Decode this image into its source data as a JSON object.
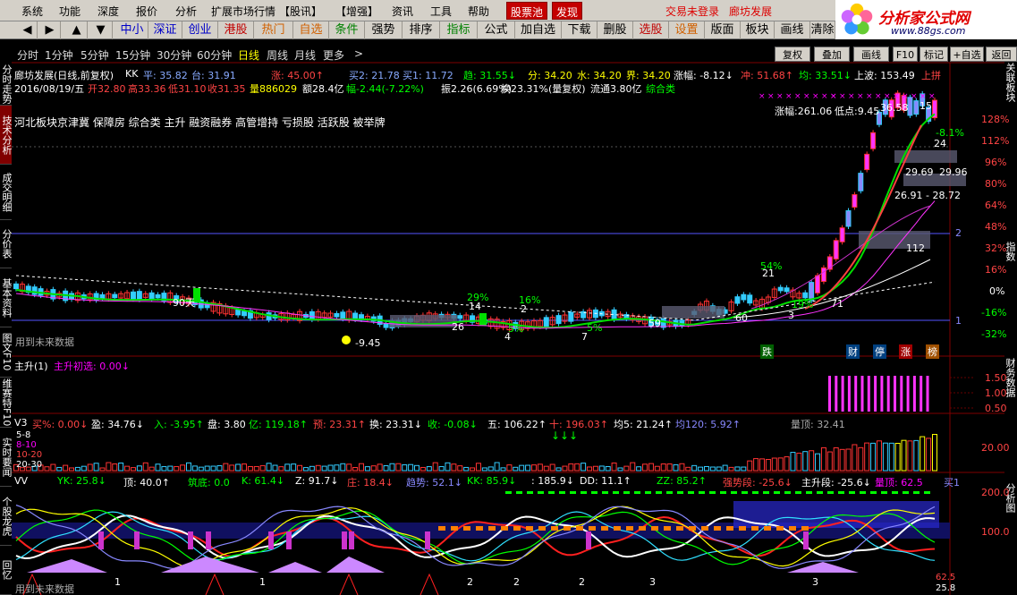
{
  "menu": {
    "items": [
      "系统",
      "功能",
      "深度",
      "报价",
      "分析",
      "扩展市场行情",
      "【股讯】",
      "【增强】",
      "资讯",
      "工具",
      "帮助"
    ],
    "stock_pool": "股票池",
    "discover": "发现",
    "status_left": "交易未登录",
    "status_right": "廊坊发展"
  },
  "logo": {
    "title": "分析家公式网",
    "url": "www.88gs.com"
  },
  "toolbar": {
    "nav": [
      "◀",
      "▶",
      "▲",
      "▼"
    ],
    "items": [
      "中小",
      "深证",
      "创业",
      "港股",
      "热门",
      "自选",
      "条件",
      "强势",
      "排序",
      "指标",
      "公式",
      "加自选",
      "下载",
      "删股",
      "选股",
      "设置",
      "版面",
      "板块",
      "画线",
      "清除"
    ]
  },
  "periods": [
    "分时",
    "1分钟",
    "5分钟",
    "15分钟",
    "30分钟",
    "60分钟",
    "日线",
    "周线",
    "月线",
    "更多",
    ">"
  ],
  "right_buttons": [
    "复权",
    "叠加",
    "画线",
    "F10",
    "标记",
    "+自选",
    "返回"
  ],
  "left_tabs": [
    "分时走势",
    "技术分析",
    "成交明细",
    "分价表",
    "基本资料",
    "图文F10",
    "维赛特F10",
    "实时要闻",
    "个股龙虎",
    "回忆"
  ],
  "right_tabs": [
    "关联板块",
    "指数",
    "财务数据",
    "分析图"
  ],
  "header": {
    "name": "廊坊发展(日线,前复权)",
    "kk": "KK",
    "ping": "平: 35.82",
    "tai": "台: 31.91",
    "zhang": "涨: 45.00↑",
    "mai2": "买2: 21.78",
    "mai1": "买1: 11.72",
    "qu": "趋: 31.55↓",
    "fen": "分: 34.20",
    "shui": "水: 34.20",
    "jie": "界: 34.20",
    "zhangfu": "涨幅: -8.12↓",
    "chong": "冲: 51.68↑",
    "jun": "均: 33.51↓",
    "shangbo": "上波: 153.49",
    "shangjin": "上拼"
  },
  "info_line": {
    "date": "2016/08/19/五",
    "open": "开32.80",
    "high": "高33.36",
    "low": "低31.10",
    "close": "收31.35",
    "vol": "量886029",
    "amount": "额28.4亿",
    "change": "幅-2.44(-7.22%)",
    "amplitude": "振2.26(6.69%)",
    "turnover": "换23.31%(量复权)",
    "float": "流通3.80亿",
    "category": "综合类"
  },
  "concepts": "河北板块京津冀 保障房 综合类 主升 融资融券 高管增持 亏损股 活跃股 被举牌",
  "chart": {
    "amp_label": "涨幅:261.06",
    "low_label": "低点:9.45",
    "top_price": "36.58",
    "top_label": "15",
    "low_price": "-9.45",
    "future_text": "用到未来数据",
    "annotations": [
      "90天",
      "29%",
      "16%",
      "54%",
      "14",
      "2",
      "26",
      "4",
      "5%",
      "7",
      "5%",
      "59",
      "60",
      "21",
      "3",
      "19%",
      "71",
      "112",
      "1",
      "2",
      "-8.1%",
      "24",
      "26.91 - 28.72",
      "29.69",
      "29.96"
    ],
    "event_labels": [
      "跌",
      "财",
      "停",
      "涨",
      "榜"
    ],
    "y_ticks": [
      "128%",
      "112%",
      "96%",
      "80%",
      "64%",
      "48%",
      "32%",
      "16%",
      "0%",
      "-16%",
      "-32%"
    ]
  },
  "panel1": {
    "title": "主升(1)",
    "sub": "主升初选: 0.00↓",
    "ticks": [
      "1.50",
      "1.00",
      "0.50"
    ]
  },
  "panel2": {
    "items": [
      "V3",
      "买%: 0.00↓",
      "盈: 34.76↓",
      "入: -3.95↑",
      "盘: 3.80",
      "亿: 119.18↑",
      "预: 23.31↑",
      "换: 23.31↓",
      "收: -0.08↓",
      "五: 106.22↑",
      "十: 196.03↑",
      "均5: 21.24↑",
      "均120: 5.92↑",
      "量顶: 32.41"
    ],
    "legend": [
      "5-8",
      "8-10",
      "10-20",
      "20-30"
    ],
    "tick": "20.00"
  },
  "panel3": {
    "items": [
      "VV",
      "YK: 25.8↓",
      "顶: 40.0↑",
      "筑底: 0.0",
      "K: 61.4↓",
      "Z: 91.7↓",
      "庄: 18.4↓",
      "趋势: 52.1↓",
      "KK: 85.9↓",
      ": 185.9↓",
      "DD: 11.1↑",
      "ZZ: 85.2↑",
      "强势段: -25.6↓",
      "主升段: -25.6↓",
      "量顶: 62.5",
      "买1"
    ],
    "ticks": [
      "200.0",
      "100.0"
    ],
    "future_text": "用到未来数据",
    "bottom_nums": [
      "1",
      "1",
      "2",
      "2",
      "2",
      "3",
      "3"
    ],
    "right_vals": [
      "62.5",
      "25.8"
    ]
  }
}
